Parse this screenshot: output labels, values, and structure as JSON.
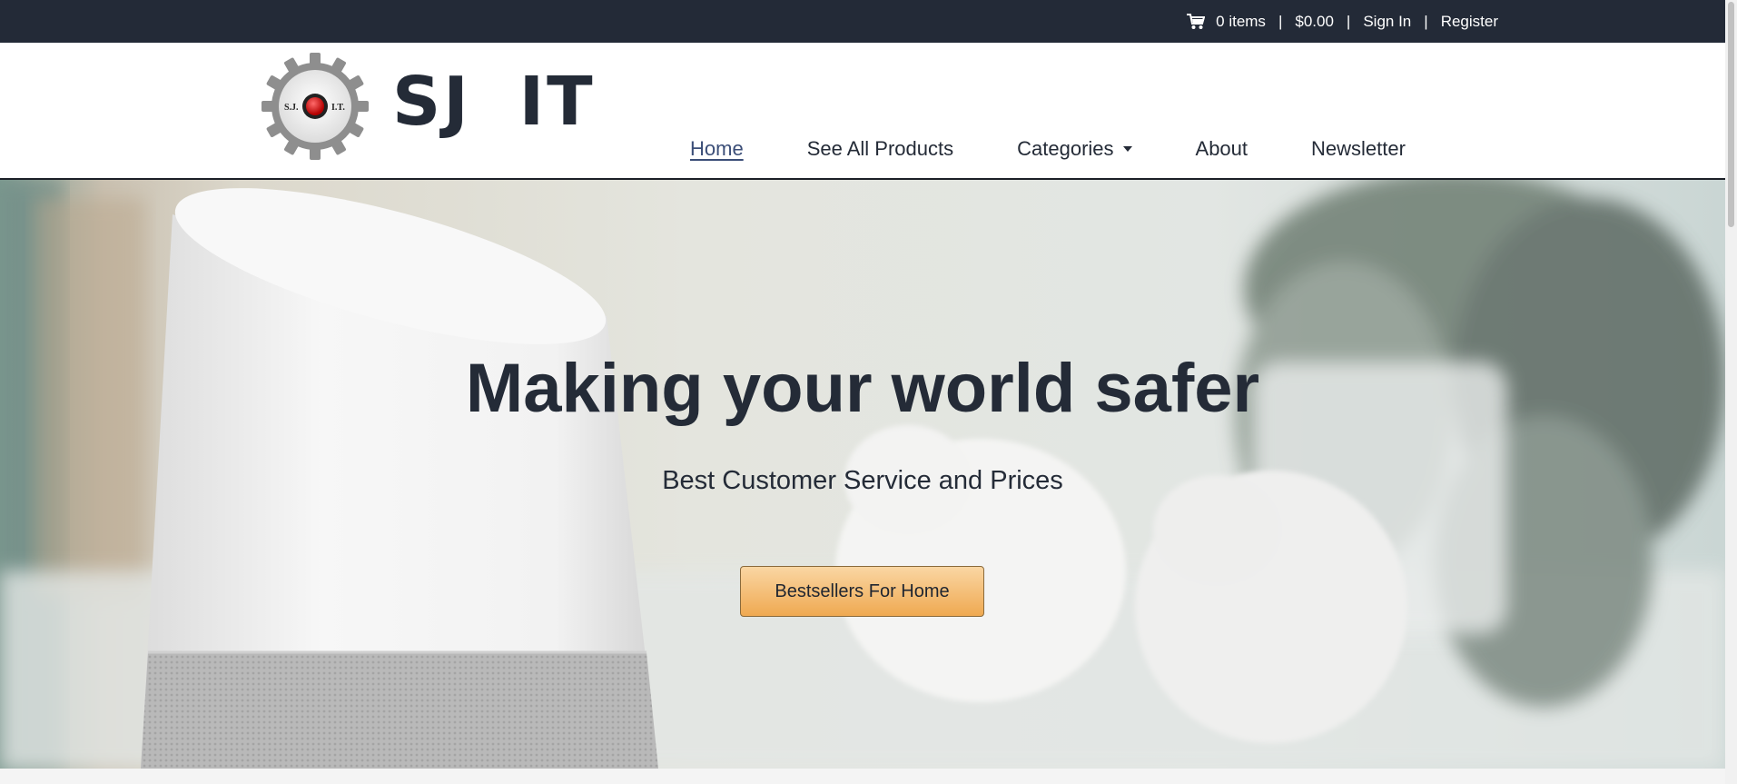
{
  "topbar": {
    "items_count": "0 items",
    "total": "$0.00",
    "sign_in": "Sign In",
    "register": "Register",
    "separator": "|",
    "cart_icon": "shopping-cart-icon"
  },
  "brand": {
    "logo_text_left": "S.J.",
    "logo_text_right": "I.T.",
    "name": "SJ IT"
  },
  "nav": {
    "items": [
      {
        "label": "Home"
      },
      {
        "label": "See All Products"
      },
      {
        "label": "Categories"
      },
      {
        "label": "About"
      },
      {
        "label": "Newsletter"
      }
    ]
  },
  "hero": {
    "title": "Making your world safer",
    "subtitle": "Best Customer Service and Prices",
    "button": "Bestsellers For Home"
  },
  "colors": {
    "topbar_bg": "#232a37",
    "text_dark": "#242b37",
    "button_gradient_top": "#fad6a3",
    "button_gradient_bottom": "#efa951"
  }
}
